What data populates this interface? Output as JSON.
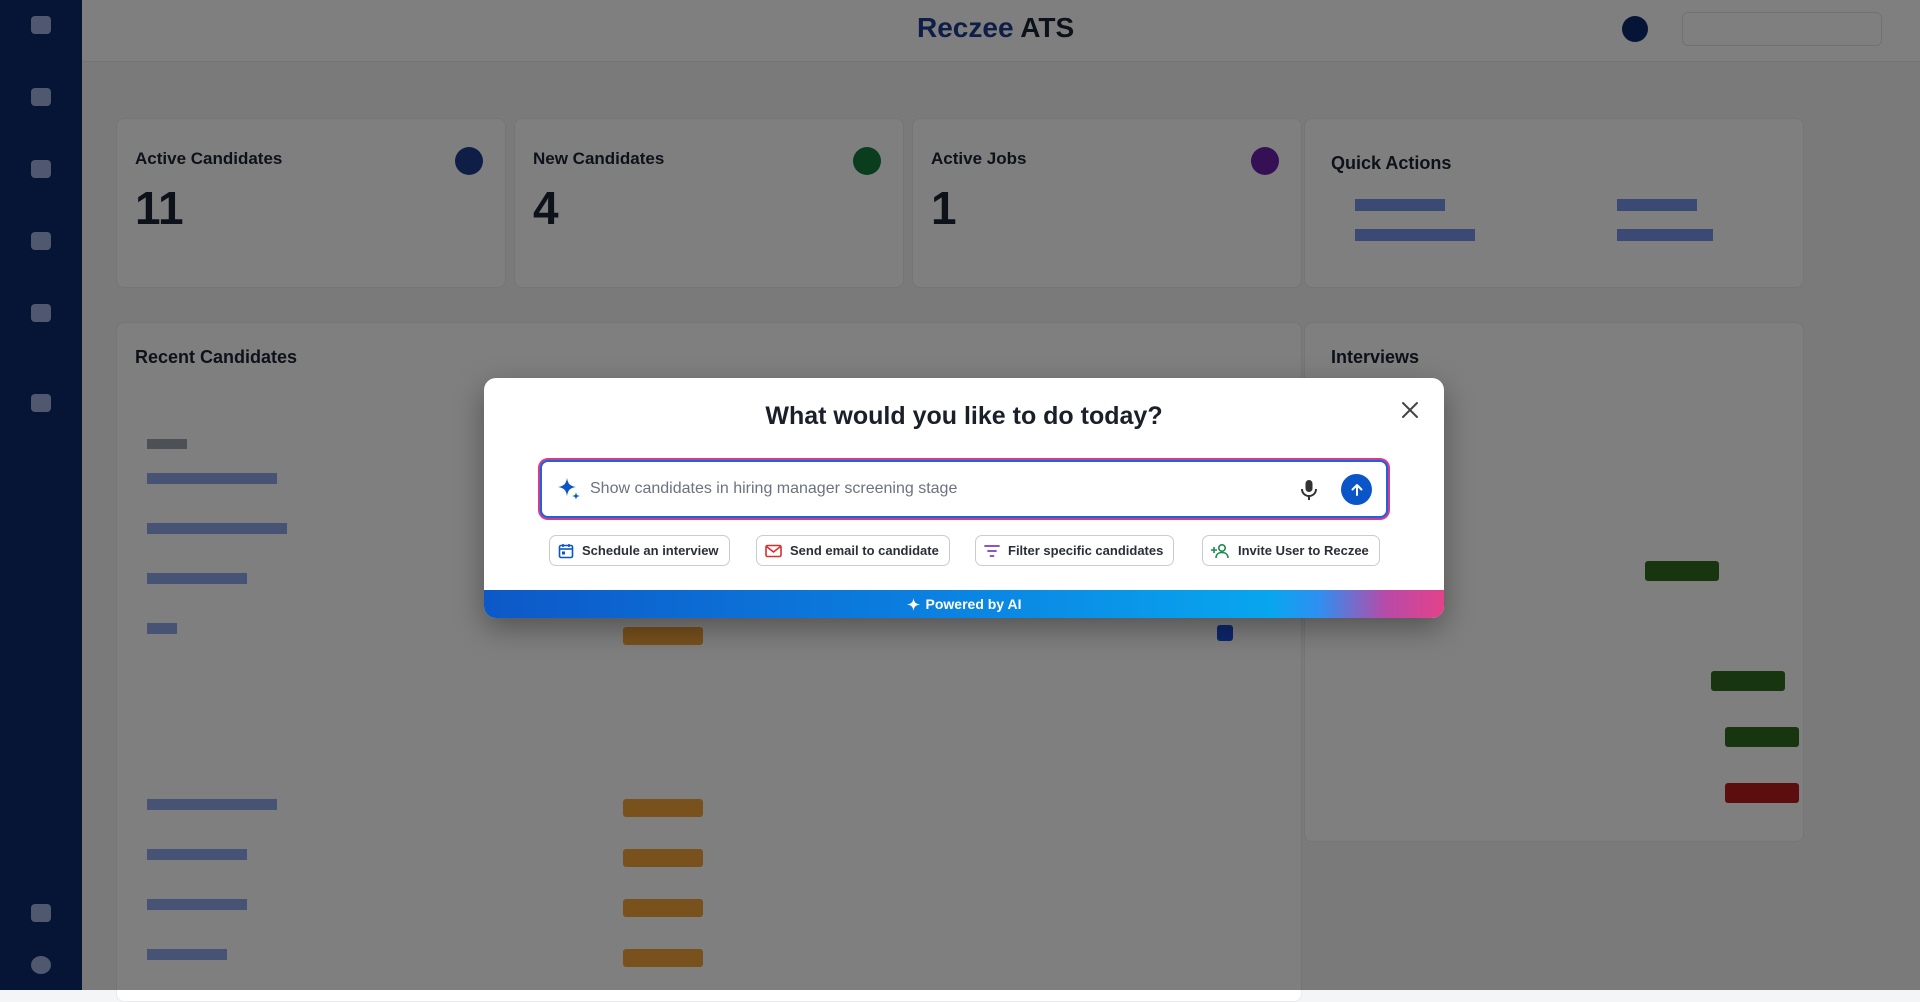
{
  "app": {
    "brand_name": "Reczee",
    "brand_suffix": "ATS"
  },
  "modal": {
    "title": "What would you like to do today?",
    "prompt_placeholder": "Show candidates in hiring manager screening stage",
    "chips": [
      {
        "label": "Schedule an interview",
        "icon": "calendar-icon"
      },
      {
        "label": "Send email to candidate",
        "icon": "mail-icon"
      },
      {
        "label": "Filter specific candidates",
        "icon": "filter-icon"
      },
      {
        "label": "Invite User to Reczee",
        "icon": "add-user-icon"
      }
    ],
    "footer_label": "Powered by AI"
  },
  "dashboard": {
    "stats": [
      {
        "title": "Active Candidates",
        "value": "11",
        "color": "#1d3d8f"
      },
      {
        "title": "New Candidates",
        "value": "4",
        "color": "#137a3d"
      },
      {
        "title": "Active Jobs",
        "value": "1",
        "color": "#6b21a8"
      }
    ],
    "quick_actions_title": "Quick Actions",
    "recent_candidates_title": "Recent Candidates",
    "interviews_title": "Interviews"
  },
  "colors": {
    "overlay": "rgba(0,0,0,0.5)",
    "accent_blue": "#0a56c9",
    "sidebar": "#0d2a6b",
    "gradient_pink": "#e2428a"
  }
}
